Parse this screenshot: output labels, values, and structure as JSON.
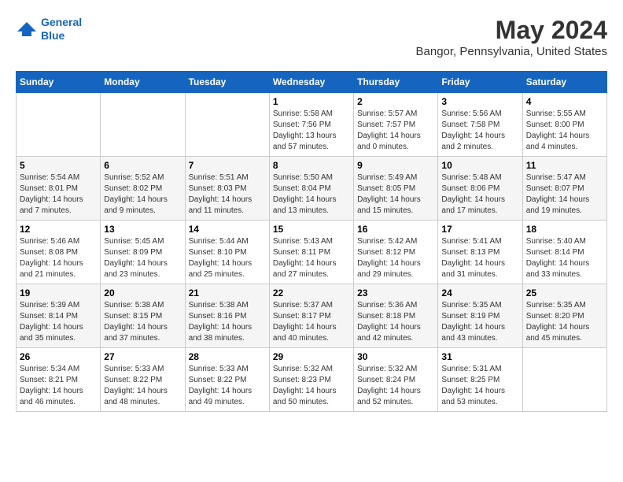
{
  "header": {
    "logo_line1": "General",
    "logo_line2": "Blue",
    "month_year": "May 2024",
    "location": "Bangor, Pennsylvania, United States"
  },
  "days_of_week": [
    "Sunday",
    "Monday",
    "Tuesday",
    "Wednesday",
    "Thursday",
    "Friday",
    "Saturday"
  ],
  "weeks": [
    [
      {
        "day": "",
        "info": ""
      },
      {
        "day": "",
        "info": ""
      },
      {
        "day": "",
        "info": ""
      },
      {
        "day": "1",
        "info": "Sunrise: 5:58 AM\nSunset: 7:56 PM\nDaylight: 13 hours\nand 57 minutes."
      },
      {
        "day": "2",
        "info": "Sunrise: 5:57 AM\nSunset: 7:57 PM\nDaylight: 14 hours\nand 0 minutes."
      },
      {
        "day": "3",
        "info": "Sunrise: 5:56 AM\nSunset: 7:58 PM\nDaylight: 14 hours\nand 2 minutes."
      },
      {
        "day": "4",
        "info": "Sunrise: 5:55 AM\nSunset: 8:00 PM\nDaylight: 14 hours\nand 4 minutes."
      }
    ],
    [
      {
        "day": "5",
        "info": "Sunrise: 5:54 AM\nSunset: 8:01 PM\nDaylight: 14 hours\nand 7 minutes."
      },
      {
        "day": "6",
        "info": "Sunrise: 5:52 AM\nSunset: 8:02 PM\nDaylight: 14 hours\nand 9 minutes."
      },
      {
        "day": "7",
        "info": "Sunrise: 5:51 AM\nSunset: 8:03 PM\nDaylight: 14 hours\nand 11 minutes."
      },
      {
        "day": "8",
        "info": "Sunrise: 5:50 AM\nSunset: 8:04 PM\nDaylight: 14 hours\nand 13 minutes."
      },
      {
        "day": "9",
        "info": "Sunrise: 5:49 AM\nSunset: 8:05 PM\nDaylight: 14 hours\nand 15 minutes."
      },
      {
        "day": "10",
        "info": "Sunrise: 5:48 AM\nSunset: 8:06 PM\nDaylight: 14 hours\nand 17 minutes."
      },
      {
        "day": "11",
        "info": "Sunrise: 5:47 AM\nSunset: 8:07 PM\nDaylight: 14 hours\nand 19 minutes."
      }
    ],
    [
      {
        "day": "12",
        "info": "Sunrise: 5:46 AM\nSunset: 8:08 PM\nDaylight: 14 hours\nand 21 minutes."
      },
      {
        "day": "13",
        "info": "Sunrise: 5:45 AM\nSunset: 8:09 PM\nDaylight: 14 hours\nand 23 minutes."
      },
      {
        "day": "14",
        "info": "Sunrise: 5:44 AM\nSunset: 8:10 PM\nDaylight: 14 hours\nand 25 minutes."
      },
      {
        "day": "15",
        "info": "Sunrise: 5:43 AM\nSunset: 8:11 PM\nDaylight: 14 hours\nand 27 minutes."
      },
      {
        "day": "16",
        "info": "Sunrise: 5:42 AM\nSunset: 8:12 PM\nDaylight: 14 hours\nand 29 minutes."
      },
      {
        "day": "17",
        "info": "Sunrise: 5:41 AM\nSunset: 8:13 PM\nDaylight: 14 hours\nand 31 minutes."
      },
      {
        "day": "18",
        "info": "Sunrise: 5:40 AM\nSunset: 8:14 PM\nDaylight: 14 hours\nand 33 minutes."
      }
    ],
    [
      {
        "day": "19",
        "info": "Sunrise: 5:39 AM\nSunset: 8:14 PM\nDaylight: 14 hours\nand 35 minutes."
      },
      {
        "day": "20",
        "info": "Sunrise: 5:38 AM\nSunset: 8:15 PM\nDaylight: 14 hours\nand 37 minutes."
      },
      {
        "day": "21",
        "info": "Sunrise: 5:38 AM\nSunset: 8:16 PM\nDaylight: 14 hours\nand 38 minutes."
      },
      {
        "day": "22",
        "info": "Sunrise: 5:37 AM\nSunset: 8:17 PM\nDaylight: 14 hours\nand 40 minutes."
      },
      {
        "day": "23",
        "info": "Sunrise: 5:36 AM\nSunset: 8:18 PM\nDaylight: 14 hours\nand 42 minutes."
      },
      {
        "day": "24",
        "info": "Sunrise: 5:35 AM\nSunset: 8:19 PM\nDaylight: 14 hours\nand 43 minutes."
      },
      {
        "day": "25",
        "info": "Sunrise: 5:35 AM\nSunset: 8:20 PM\nDaylight: 14 hours\nand 45 minutes."
      }
    ],
    [
      {
        "day": "26",
        "info": "Sunrise: 5:34 AM\nSunset: 8:21 PM\nDaylight: 14 hours\nand 46 minutes."
      },
      {
        "day": "27",
        "info": "Sunrise: 5:33 AM\nSunset: 8:22 PM\nDaylight: 14 hours\nand 48 minutes."
      },
      {
        "day": "28",
        "info": "Sunrise: 5:33 AM\nSunset: 8:22 PM\nDaylight: 14 hours\nand 49 minutes."
      },
      {
        "day": "29",
        "info": "Sunrise: 5:32 AM\nSunset: 8:23 PM\nDaylight: 14 hours\nand 50 minutes."
      },
      {
        "day": "30",
        "info": "Sunrise: 5:32 AM\nSunset: 8:24 PM\nDaylight: 14 hours\nand 52 minutes."
      },
      {
        "day": "31",
        "info": "Sunrise: 5:31 AM\nSunset: 8:25 PM\nDaylight: 14 hours\nand 53 minutes."
      },
      {
        "day": "",
        "info": ""
      }
    ]
  ]
}
